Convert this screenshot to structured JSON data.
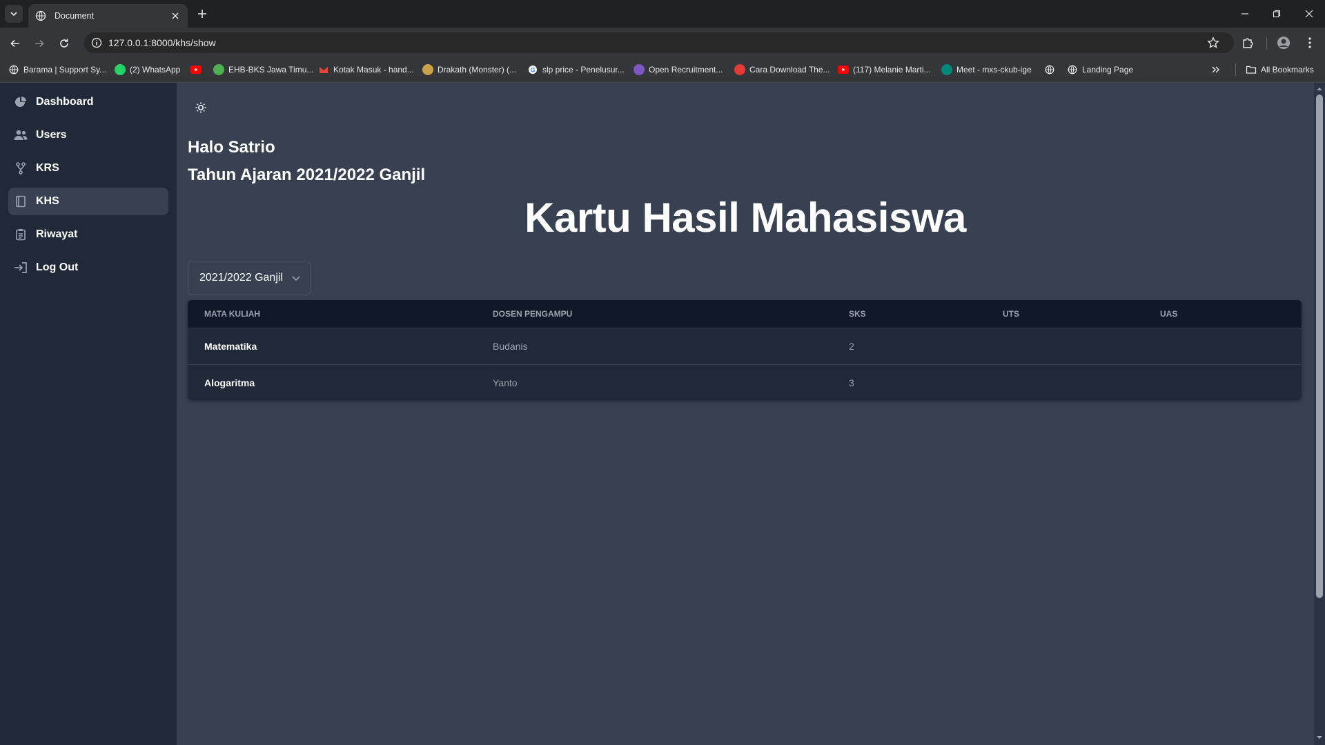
{
  "browser": {
    "tab_title": "Document",
    "url": "127.0.0.1:8000/khs/show",
    "bookmarks": [
      {
        "label": "Barama | Support Sy...",
        "icon": "globe-icon",
        "color": "#9aa0a6"
      },
      {
        "label": "(2) WhatsApp",
        "icon": "whatsapp-icon",
        "color": "#25d366"
      },
      {
        "label": "",
        "icon": "youtube-icon",
        "color": "#ff0000"
      },
      {
        "label": "EHB-BKS Jawa Timu...",
        "icon": "ehb-icon",
        "color": "#4caf50"
      },
      {
        "label": "Kotak Masuk - hand...",
        "icon": "gmail-icon",
        "color": "#ea4335"
      },
      {
        "label": "Drakath (Monster) (...",
        "icon": "drakath-icon",
        "color": "#c8a24a"
      },
      {
        "label": "slp price - Penelusur...",
        "icon": "google-icon",
        "color": "#4285f4"
      },
      {
        "label": "Open Recruitment...",
        "icon": "forms-icon",
        "color": "#7e57c2"
      },
      {
        "label": "Cara Download The...",
        "icon": "s-icon",
        "color": "#e53935"
      },
      {
        "label": "(117) Melanie Marti...",
        "icon": "youtube-icon",
        "color": "#ff0000"
      },
      {
        "label": "Meet - mxs-ckub-ige",
        "icon": "meet-icon",
        "color": "#00897b"
      },
      {
        "label": "",
        "icon": "globe-icon",
        "color": "#9aa0a6"
      },
      {
        "label": "Landing Page",
        "icon": "globe-icon",
        "color": "#9aa0a6"
      }
    ],
    "all_bookmarks": "All Bookmarks"
  },
  "sidebar": {
    "items": [
      {
        "label": "Dashboard",
        "icon": "pie-chart-icon",
        "active": false
      },
      {
        "label": "Users",
        "icon": "users-icon",
        "active": false
      },
      {
        "label": "KRS",
        "icon": "git-branch-icon",
        "active": false
      },
      {
        "label": "KHS",
        "icon": "book-icon",
        "active": true
      },
      {
        "label": "Riwayat",
        "icon": "clipboard-icon",
        "active": false
      },
      {
        "label": "Log Out",
        "icon": "logout-icon",
        "active": false
      }
    ]
  },
  "main": {
    "greeting": "Halo Satrio",
    "academic_year": "Tahun Ajaran 2021/2022 Ganjil",
    "title": "Kartu Hasil Mahasiswa",
    "semester_select": {
      "selected": "2021/2022 Ganjil"
    },
    "table": {
      "headers": [
        "Mata Kuliah",
        "Dosen Pengampu",
        "SKS",
        "UTS",
        "UAS"
      ],
      "rows": [
        {
          "course": "Matematika",
          "lecturer": "Budanis",
          "sks": "2",
          "uts": "",
          "uas": ""
        },
        {
          "course": "Alogaritma",
          "lecturer": "Yanto",
          "sks": "3",
          "uts": "",
          "uas": ""
        }
      ]
    }
  },
  "colors": {
    "page_bg": "#374151",
    "sidebar_bg": "#1f2937",
    "table_header_bg": "#111827",
    "table_row_bg": "#1f2937"
  }
}
